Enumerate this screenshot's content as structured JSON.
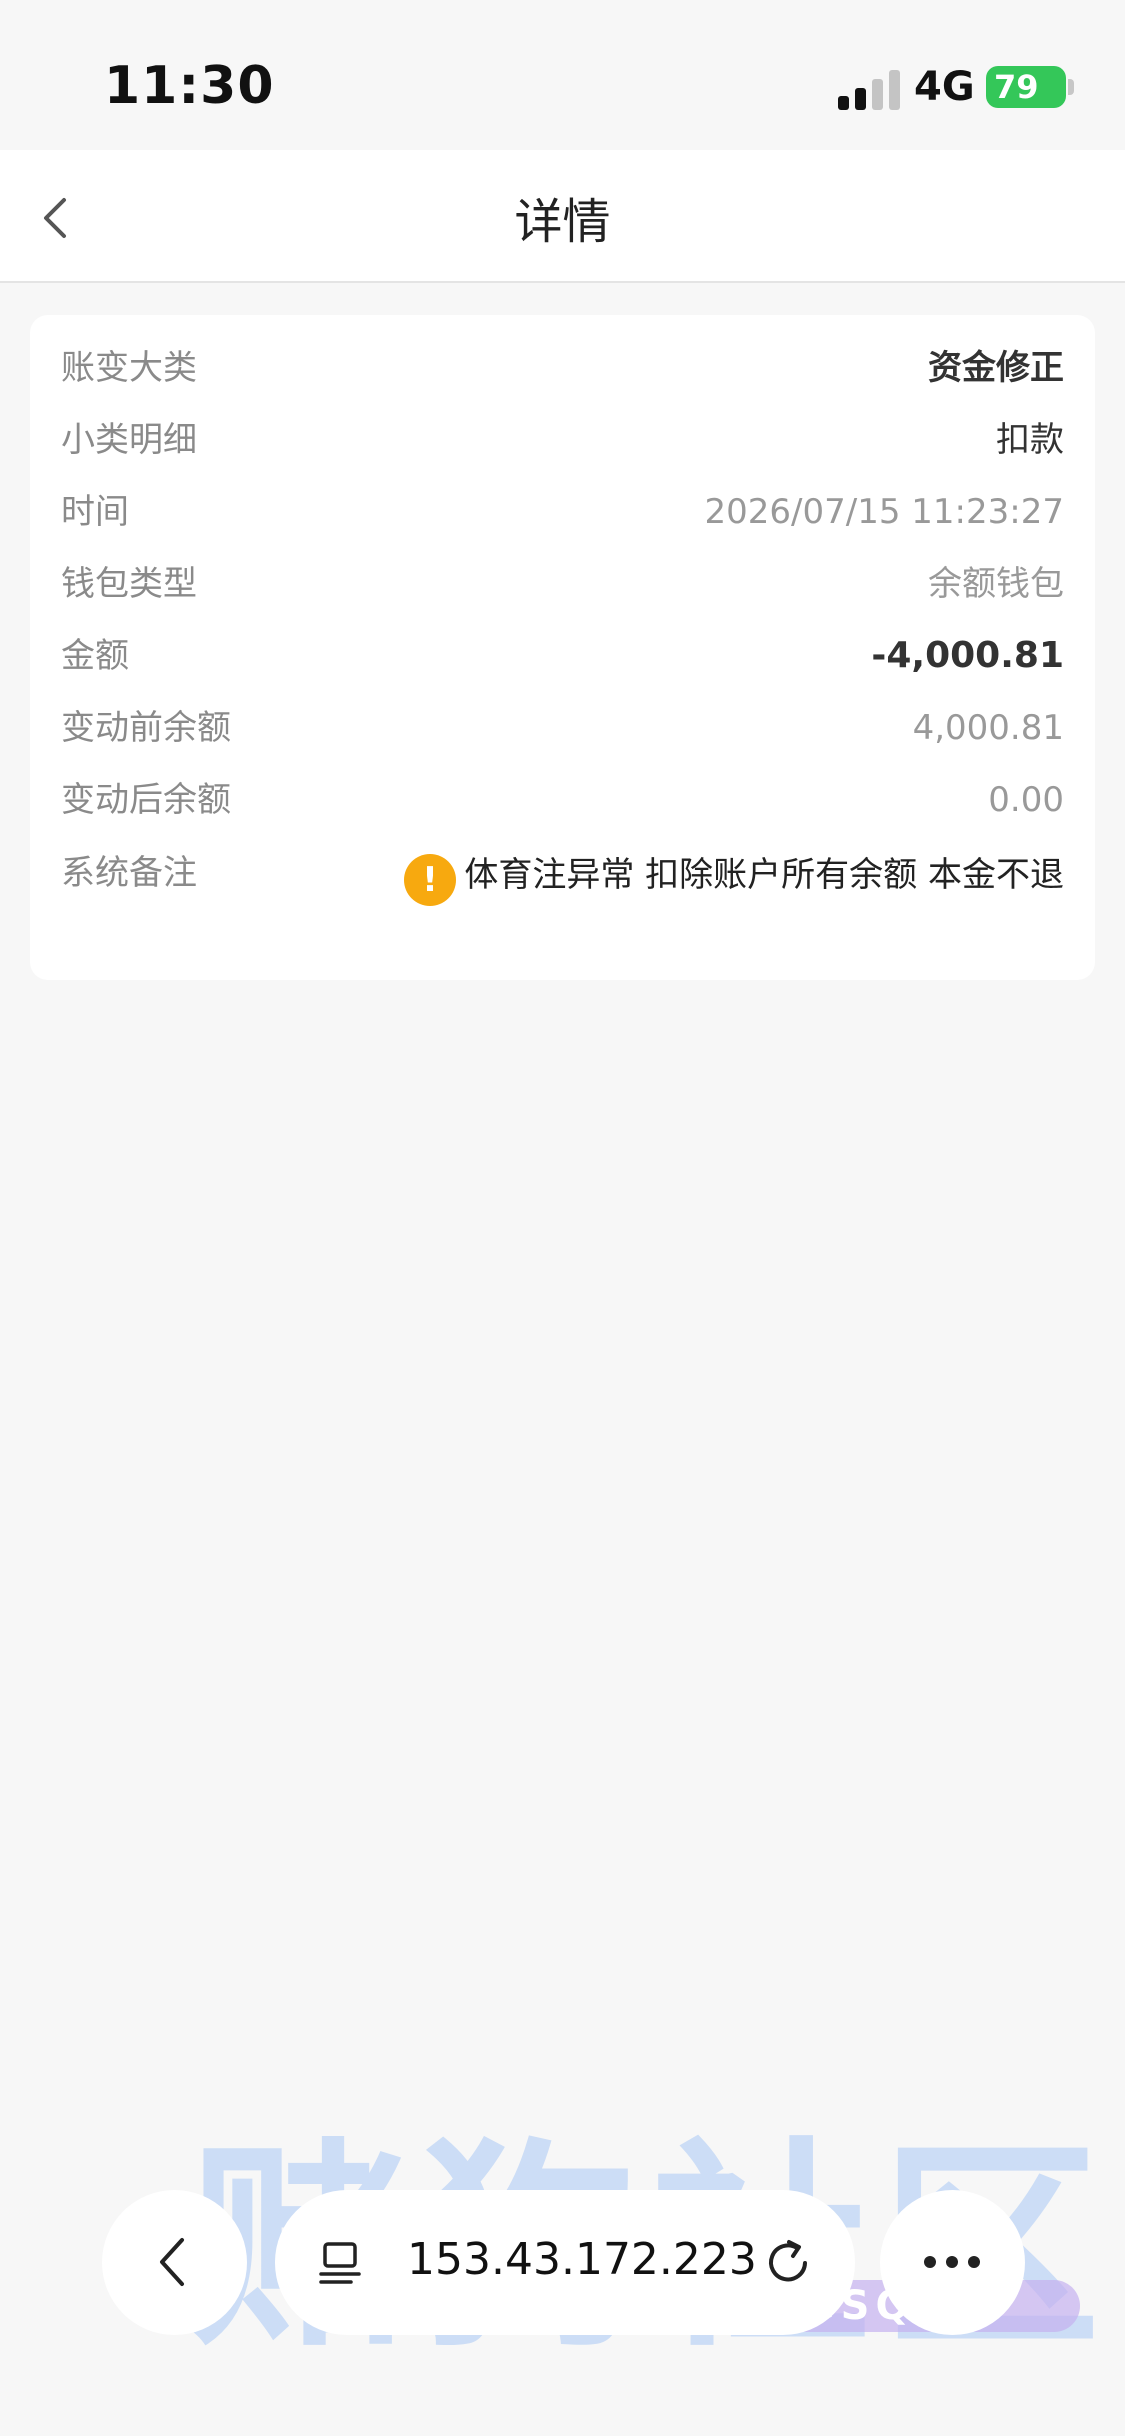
{
  "status_bar": {
    "time": "11:30",
    "network": "4G",
    "battery": "79"
  },
  "header": {
    "title": "详情"
  },
  "details": {
    "rows": [
      {
        "label": "账变大类",
        "value": "资金修正"
      },
      {
        "label": "小类明细",
        "value": "扣款"
      },
      {
        "label": "时间",
        "value": "2026/07/15 11:23:27"
      },
      {
        "label": "钱包类型",
        "value": "余额钱包"
      },
      {
        "label": "金额",
        "value": "-4,000.81"
      },
      {
        "label": "变动前余额",
        "value": "4,000.81"
      },
      {
        "label": "变动后余额",
        "value": "0.00"
      }
    ],
    "remark": {
      "label": "系统备注",
      "value": "体育注异常 扣除账户所有余额 本金不退"
    }
  },
  "watermark": {
    "text": "赌狗社区",
    "sub": "DGSQ.CC"
  },
  "browser": {
    "url": "153.43.172.223"
  },
  "icons": {
    "back": "chevron-left-icon",
    "warning": "exclamation-circle-icon",
    "tabs": "tabs-icon",
    "reload": "reload-icon",
    "more": "ellipsis-icon"
  },
  "colors": {
    "warning": "#f7a90f",
    "battery": "#34c759",
    "background": "#f7f7f7"
  }
}
